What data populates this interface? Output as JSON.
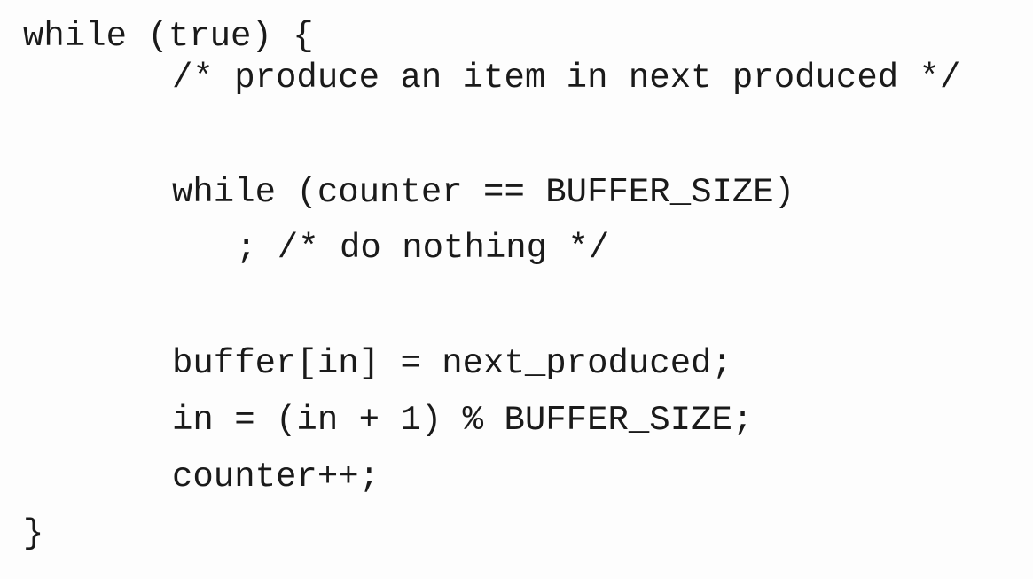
{
  "code": {
    "lines": [
      "while (true) {",
      "/* produce an item in next produced */",
      "while (counter == BUFFER_SIZE)",
      "; /* do nothing */",
      "buffer[in] = next_produced;",
      "in = (in + 1) % BUFFER_SIZE;",
      "counter++;",
      "}"
    ]
  }
}
